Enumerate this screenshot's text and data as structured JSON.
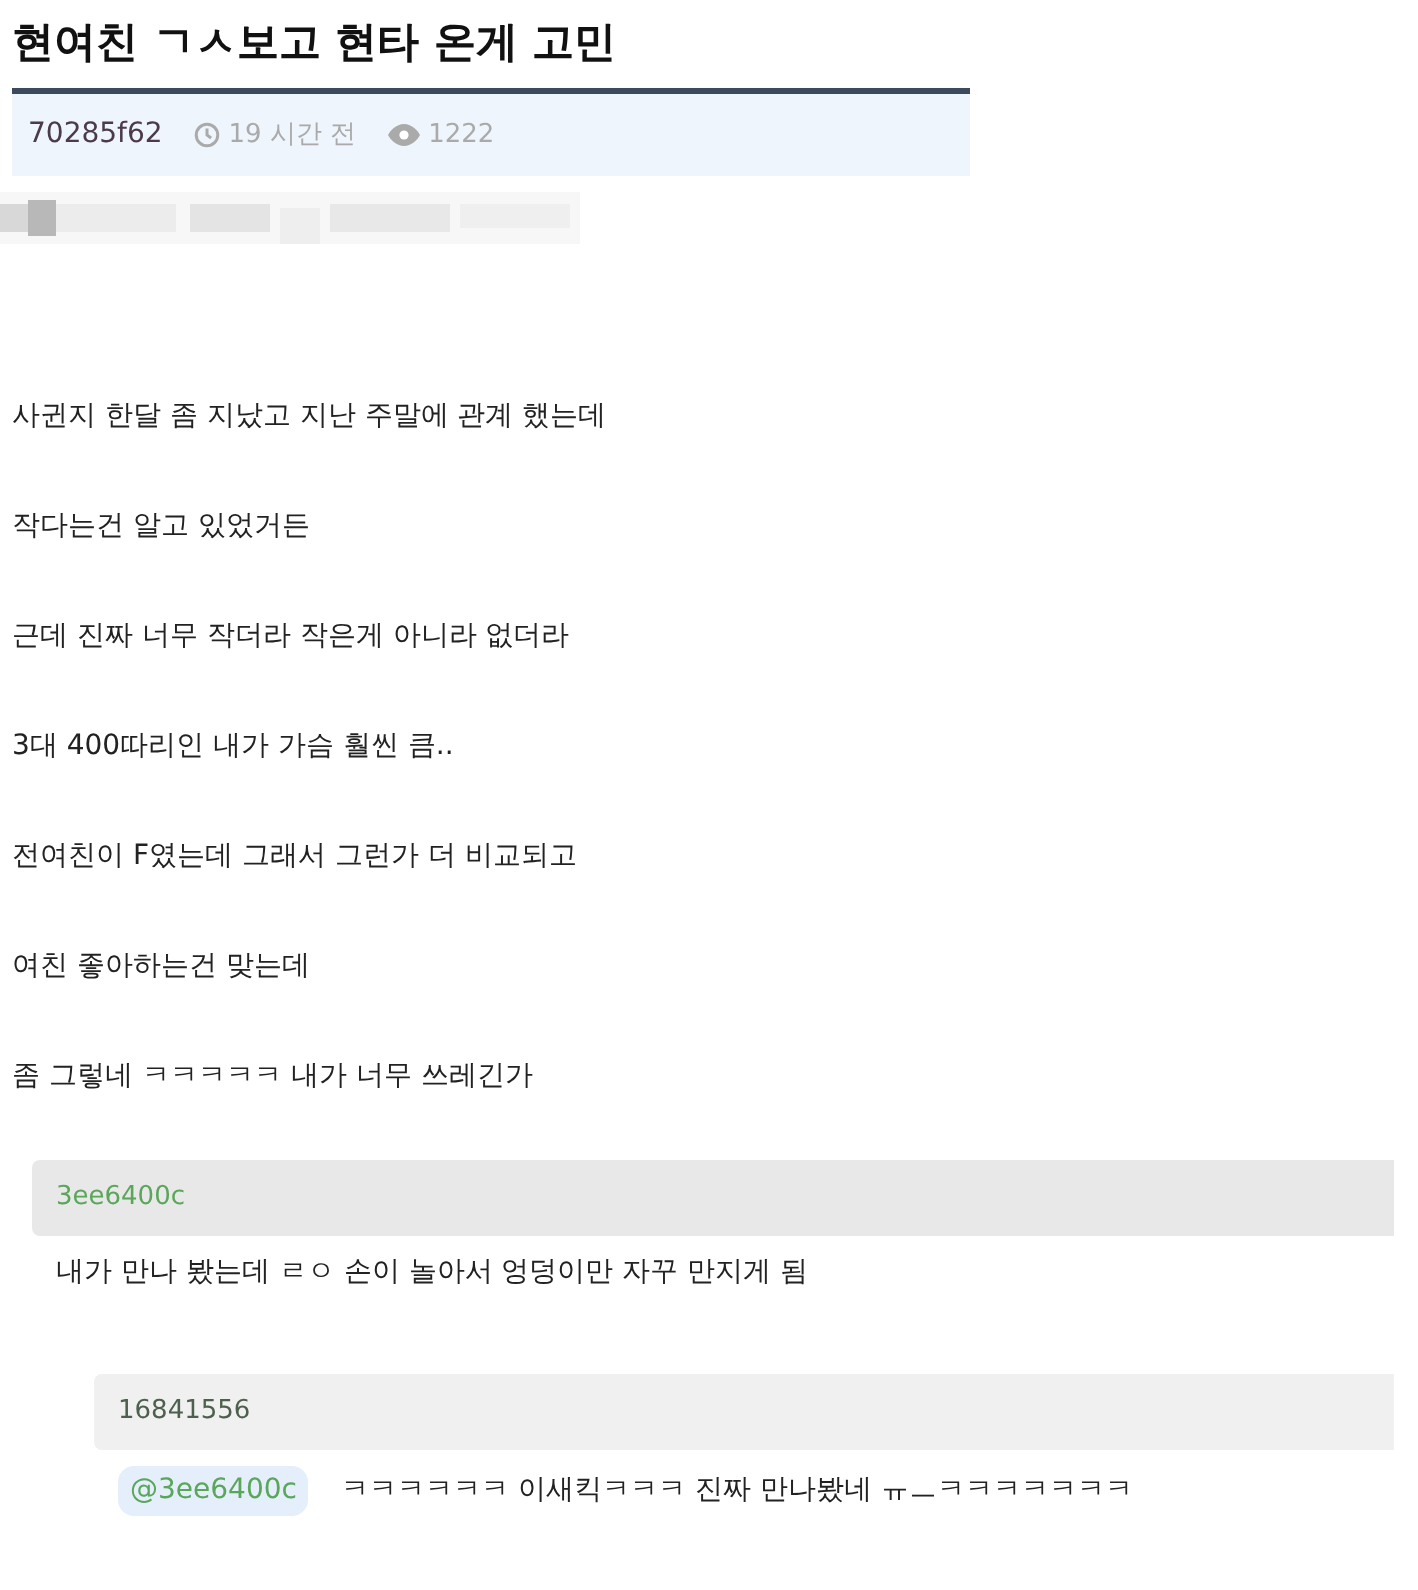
{
  "post": {
    "title": "현여친 ㄱㅅ보고 현타 온게 고민",
    "author": "70285f62",
    "time": "19 시간 전",
    "views": "1222",
    "paragraphs": [
      "사귄지 한달 좀 지났고 지난 주말에 관계 했는데",
      "작다는건 알고 있었거든",
      "근데 진짜 너무 작더라 작은게 아니라 없더라",
      "3대 400따리인 내가 가슴 훨씬 큼..",
      "전여친이 F였는데 그래서 그런가 더 비교되고",
      "여친 좋아하는건 맞는데",
      "좀 그렇네 ㅋㅋㅋㅋㅋ 내가 너무 쓰레긴가"
    ]
  },
  "comments": [
    {
      "author": "3ee6400c",
      "text": "내가 만나 봤는데 ㄹㅇ 손이 놀아서 엉덩이만 자꾸 만지게 됨",
      "children": [
        {
          "author": "16841556",
          "mention": "@3ee6400c",
          "text": "ㅋㅋㅋㅋㅋㅋ 이새킥ㅋㅋㅋ 진짜 만나봤네 ㅠㅡㅋㅋㅋㅋㅋㅋㅋ"
        }
      ]
    }
  ]
}
